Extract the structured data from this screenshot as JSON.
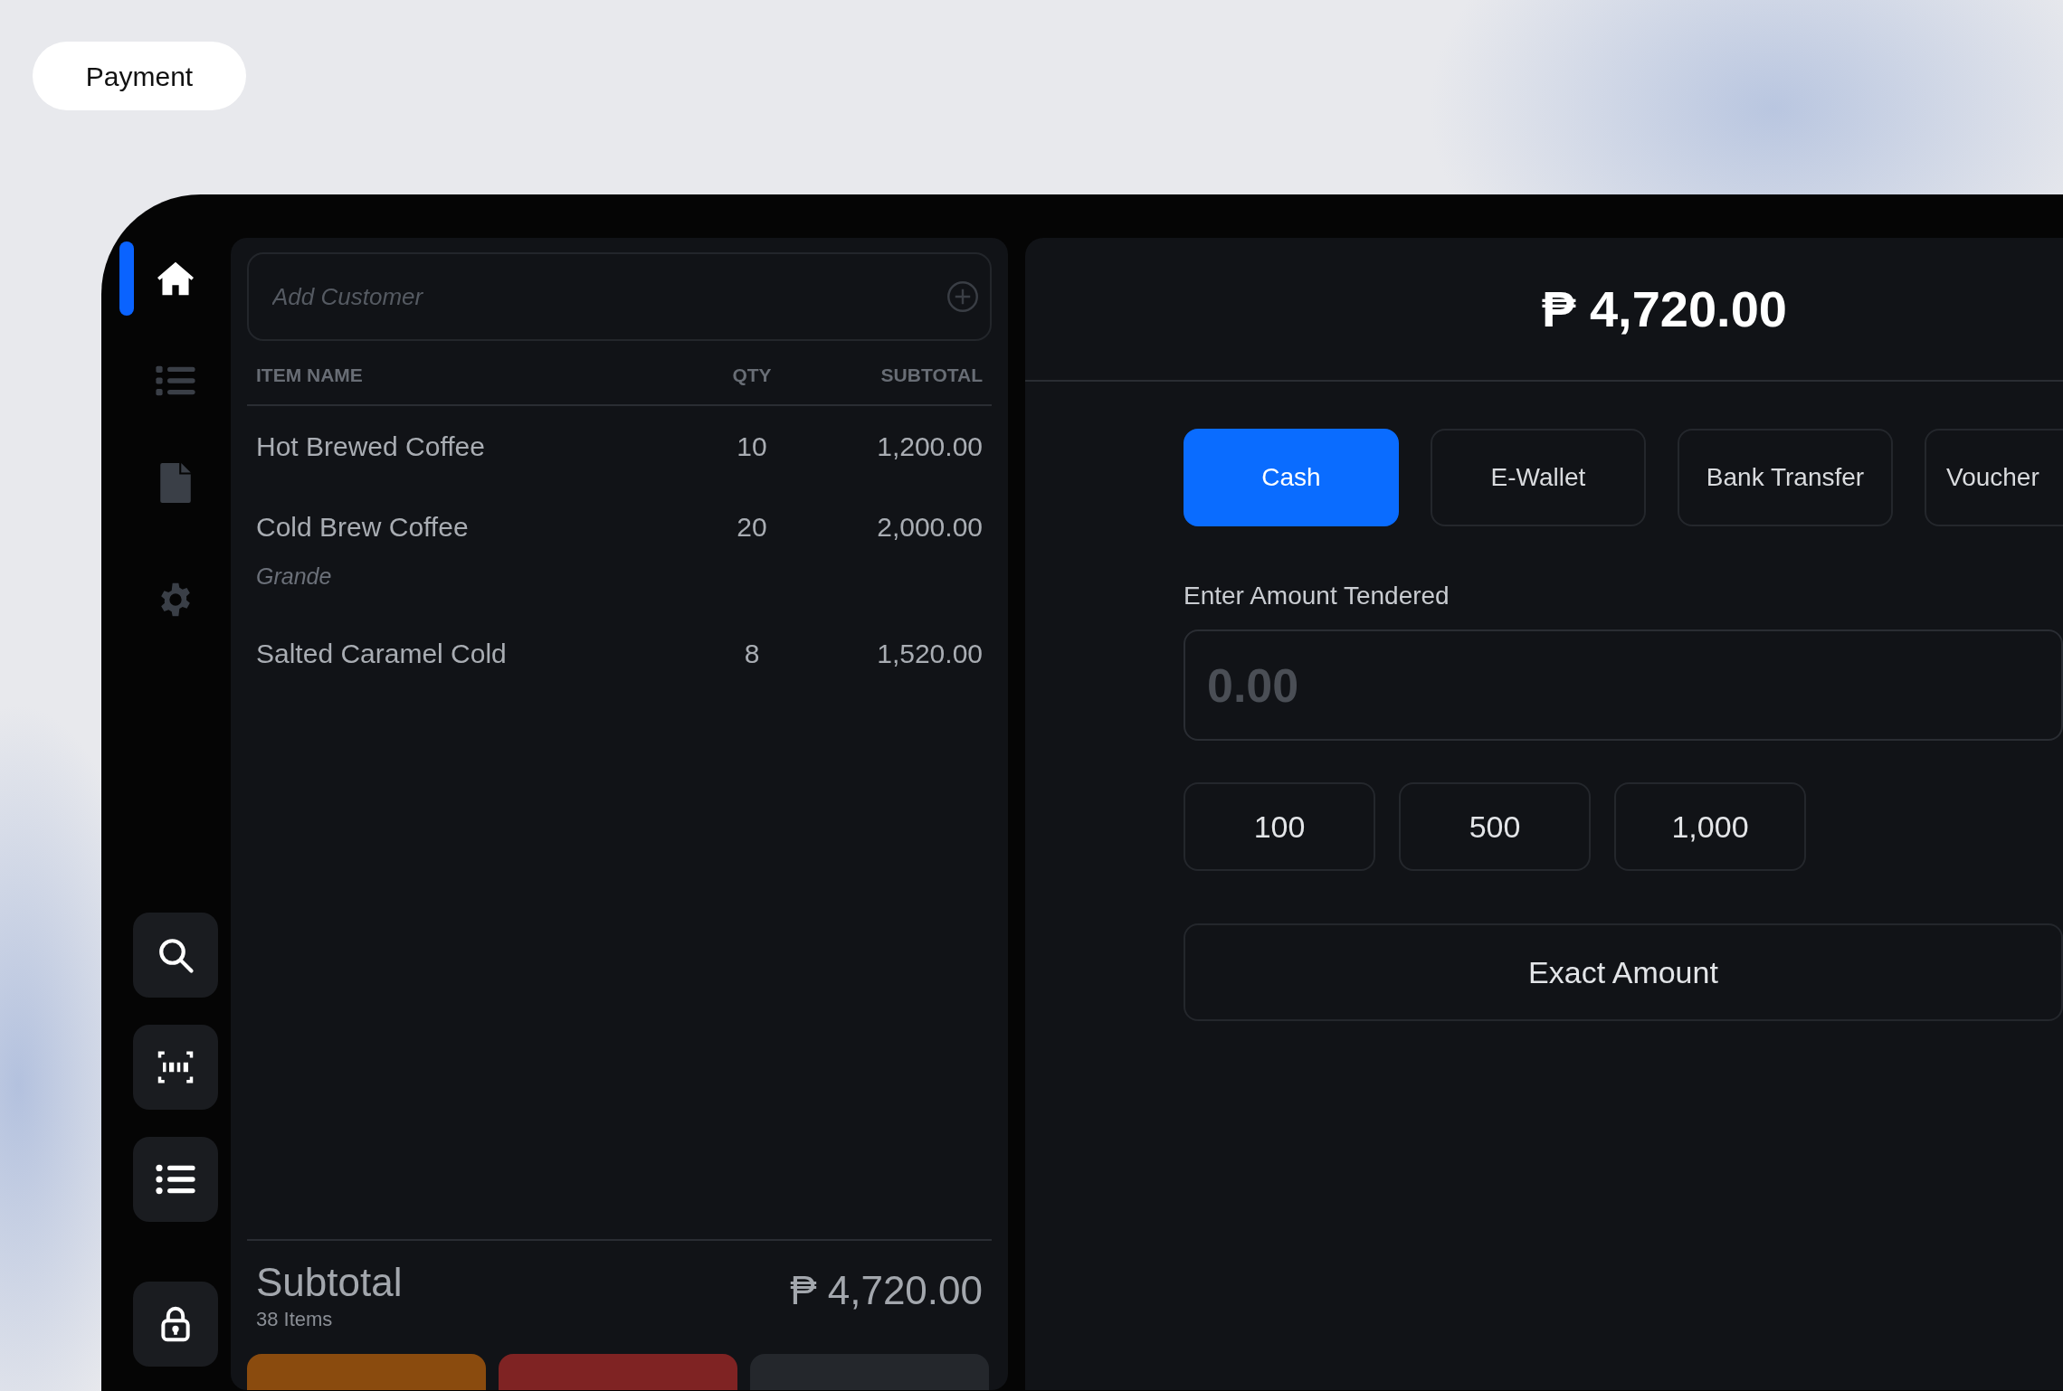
{
  "page_label": "Payment",
  "sidebar": {
    "nav": [
      {
        "selected": true
      },
      {
        "selected": false
      },
      {
        "selected": false
      },
      {
        "selected": false
      }
    ],
    "tools": [
      {
        "kind": "search"
      },
      {
        "kind": "scan"
      },
      {
        "kind": "list"
      },
      {
        "kind": "lock"
      }
    ]
  },
  "cart": {
    "customer": {
      "placeholder": "Add Customer"
    },
    "columns": [
      "ITEM NAME",
      "QTY",
      "SUBTOTAL"
    ],
    "rows": [
      {
        "name": "Hot Brewed Coffee",
        "qty": "10",
        "subtotal": "1,200.00"
      },
      {
        "name": "Cold Brew Coffee",
        "qty": "20",
        "subtotal": "2,000.00",
        "note": "Grande"
      },
      {
        "name": "Salted Caramel Cold",
        "qty": "8",
        "subtotal": "1,520.00"
      }
    ],
    "subtotal": {
      "label": "Subtotal",
      "count": "38 Items",
      "amount": "₱ 4,720.00"
    },
    "actions": [
      {
        "color": "#8a4b0e"
      },
      {
        "color": "#7f2323"
      },
      {
        "color": "#24272c"
      }
    ]
  },
  "payment": {
    "total": "₱ 4,720.00",
    "methods": [
      {
        "label": "Cash",
        "selected": true
      },
      {
        "label": "E-Wallet",
        "selected": false
      },
      {
        "label": "Bank Transfer",
        "selected": false
      },
      {
        "label": "Voucher",
        "selected": false
      }
    ],
    "amount_label": "Enter Amount Tendered",
    "amount_field": {
      "placeholder": "0.00"
    },
    "quick_amounts": [
      "100",
      "500",
      "1,000"
    ],
    "exact_button": "Exact Amount"
  }
}
